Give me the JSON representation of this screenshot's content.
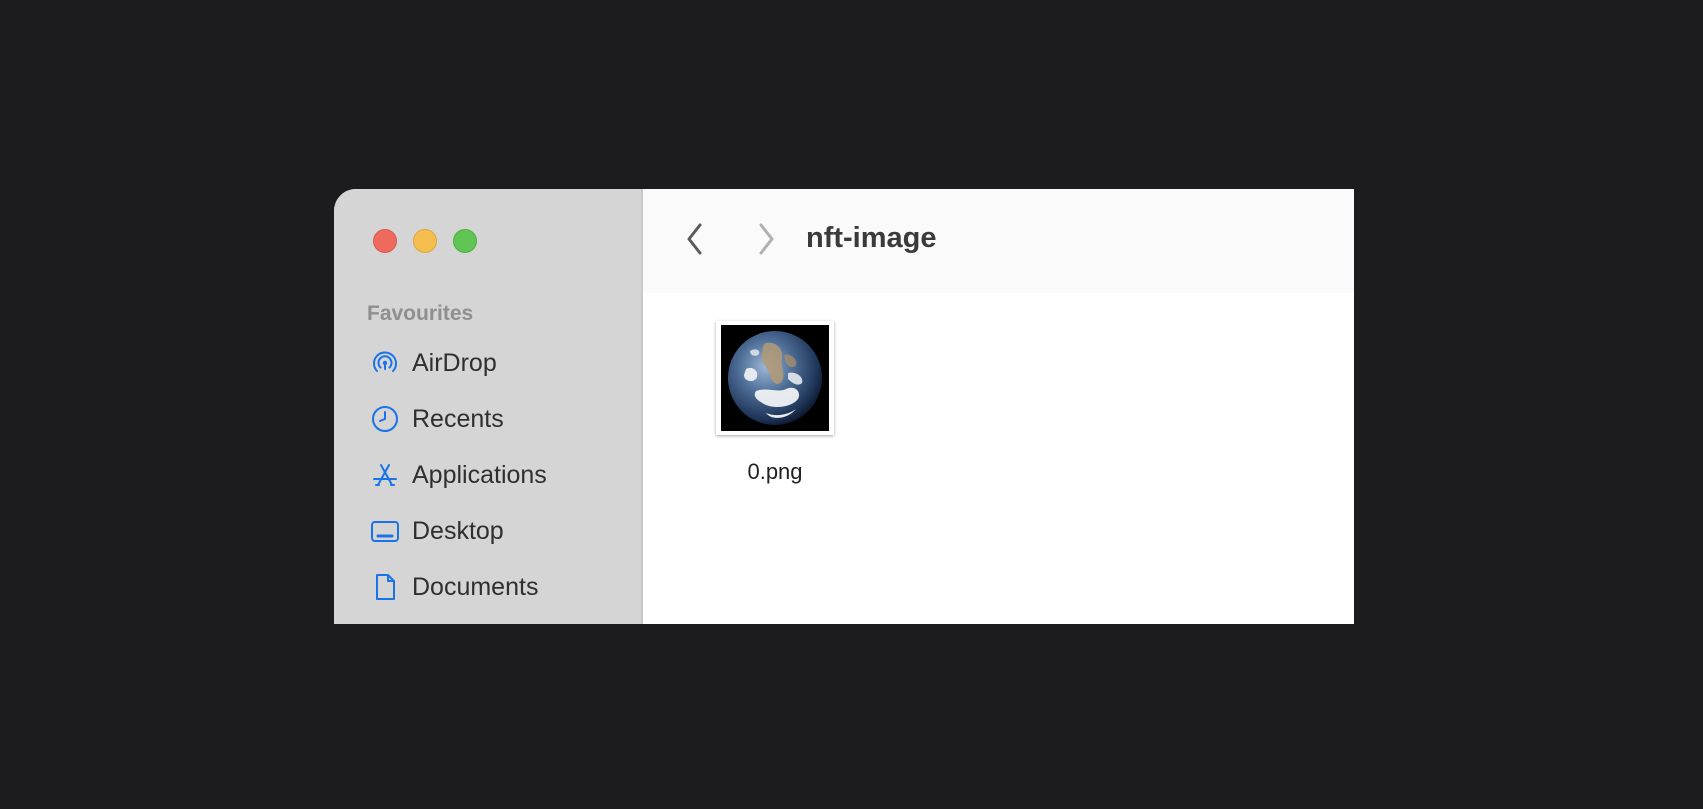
{
  "window": {
    "traffic_lights": {
      "close_color": "#ee6a5e",
      "minimize_color": "#f5bf4f",
      "maximize_color": "#61c554"
    }
  },
  "sidebar": {
    "section_title": "Favourites",
    "accent_color": "#1a73e8",
    "items": [
      {
        "label": "AirDrop",
        "icon": "airdrop-icon"
      },
      {
        "label": "Recents",
        "icon": "clock-icon"
      },
      {
        "label": "Applications",
        "icon": "applications-icon"
      },
      {
        "label": "Desktop",
        "icon": "desktop-icon"
      },
      {
        "label": "Documents",
        "icon": "document-icon"
      }
    ]
  },
  "toolbar": {
    "back_icon": "chevron-left-icon",
    "forward_icon": "chevron-right-icon",
    "folder_title": "nft-image"
  },
  "files": [
    {
      "name": "0.png",
      "thumbnail": "earth-image"
    }
  ]
}
